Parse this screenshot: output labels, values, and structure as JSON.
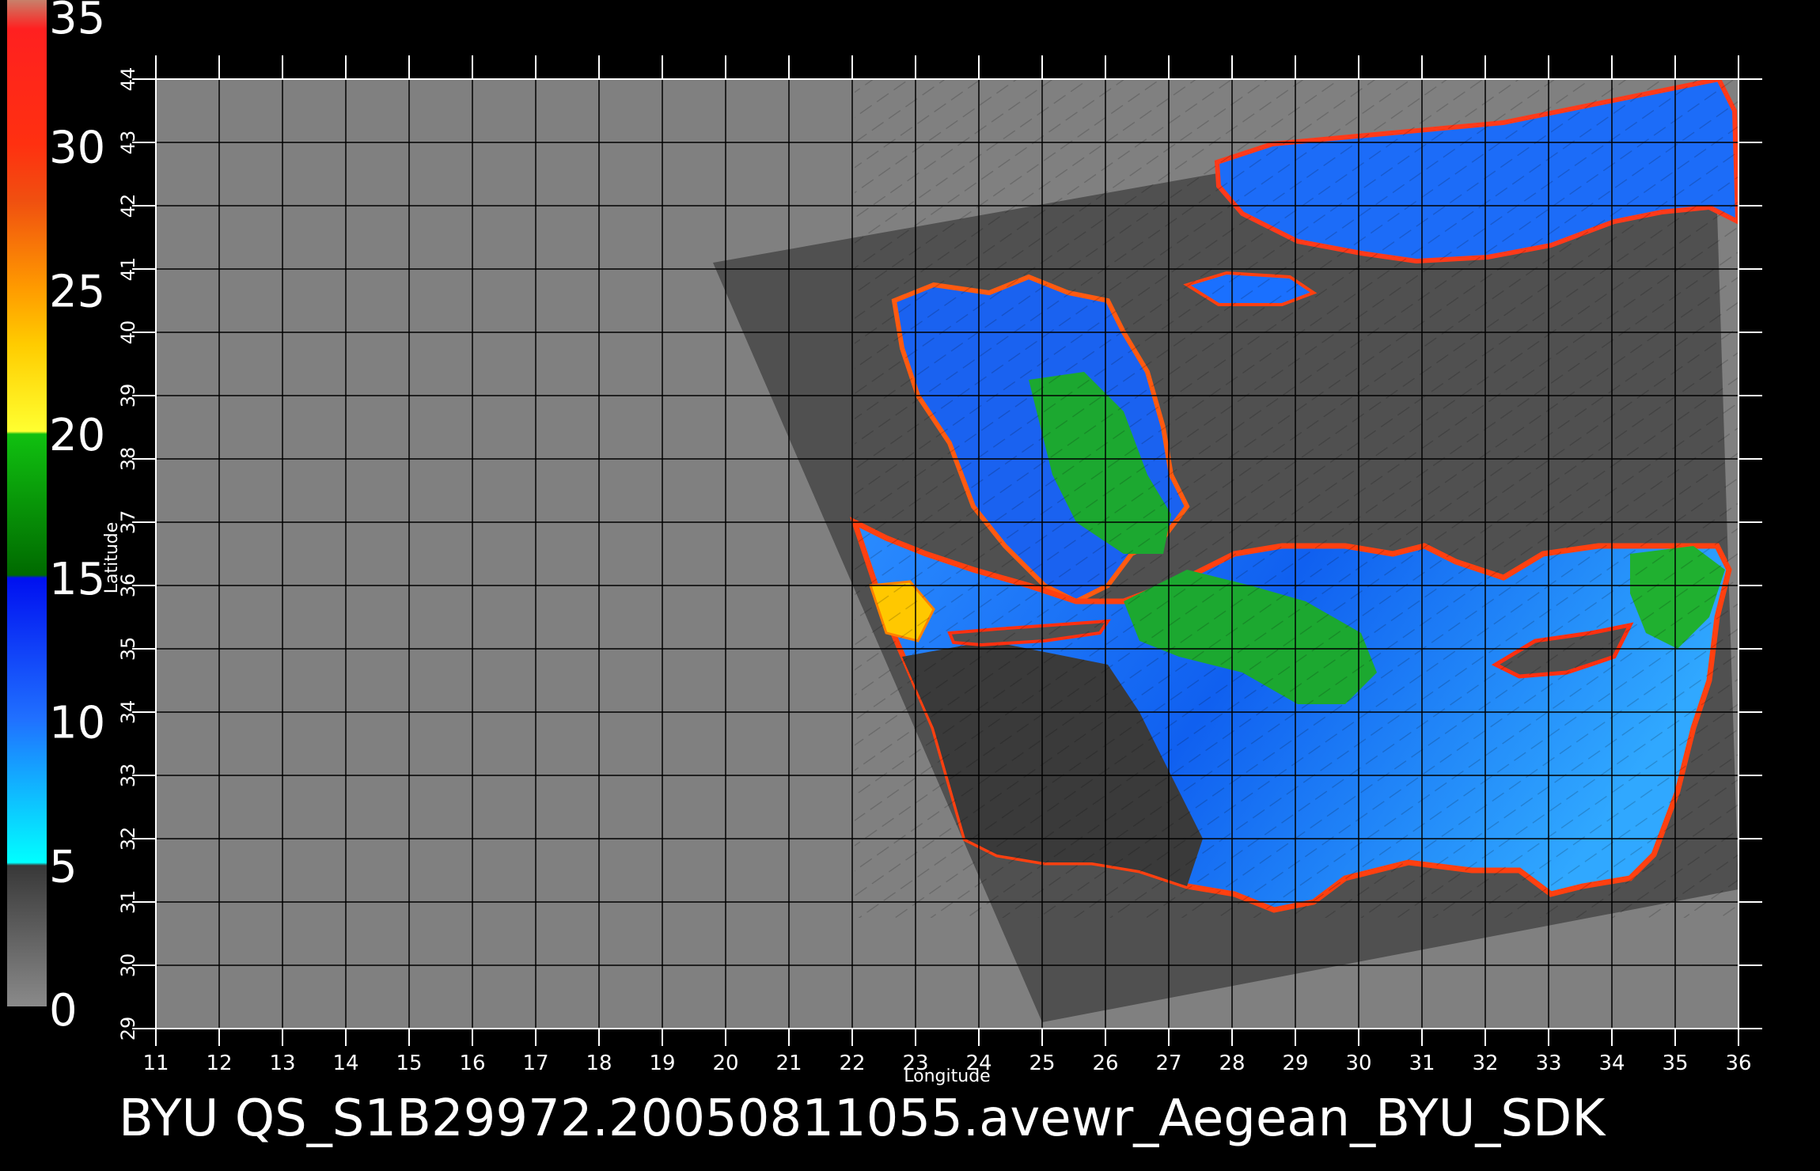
{
  "colorbar": {
    "ticks": [
      "35",
      "30",
      "25",
      "20",
      "15",
      "10",
      "5",
      "0"
    ],
    "stops": [
      {
        "value": 35,
        "color": "#c8806a"
      },
      {
        "value": 34,
        "color": "#ff2020"
      },
      {
        "value": 30,
        "color": "#ff3010"
      },
      {
        "value": 28,
        "color": "#f05010"
      },
      {
        "value": 25,
        "color": "#ff9a00"
      },
      {
        "value": 23,
        "color": "#ffcc00"
      },
      {
        "value": 20,
        "color": "#ffff30"
      },
      {
        "value": 19.9,
        "color": "#10c010"
      },
      {
        "value": 15,
        "color": "#006a00"
      },
      {
        "value": 14.9,
        "color": "#0010f0"
      },
      {
        "value": 10,
        "color": "#2070ff"
      },
      {
        "value": 5,
        "color": "#00ffff"
      },
      {
        "value": 4.9,
        "color": "#383838"
      },
      {
        "value": 0,
        "color": "#8a8a8a"
      }
    ]
  },
  "map": {
    "background_color": "#808080",
    "swath_color": "#505050",
    "lon_range": [
      11,
      36
    ],
    "lat_range": [
      29,
      44
    ],
    "lon_ticks": [
      "11",
      "12",
      "13",
      "14",
      "15",
      "16",
      "17",
      "18",
      "19",
      "20",
      "21",
      "22",
      "23",
      "24",
      "25",
      "26",
      "27",
      "28",
      "29",
      "30",
      "31",
      "32",
      "33",
      "34",
      "35",
      "36"
    ],
    "lat_ticks": [
      "29",
      "30",
      "31",
      "32",
      "33",
      "34",
      "35",
      "36",
      "37",
      "38",
      "39",
      "40",
      "41",
      "42",
      "43",
      "44"
    ],
    "xlabel": "Longitude",
    "ylabel": "Latitude",
    "swath_corners": [
      {
        "lon": 19.8,
        "lat": 41.1
      },
      {
        "lon": 35.6,
        "lat": 43.9
      },
      {
        "lon": 36.0,
        "lat": 31.2
      },
      {
        "lon": 25.0,
        "lat": 29.1
      }
    ]
  },
  "caption": "BYU  QS_S1B29972.20050811055.avewr_Aegean_BYU_SDK"
}
